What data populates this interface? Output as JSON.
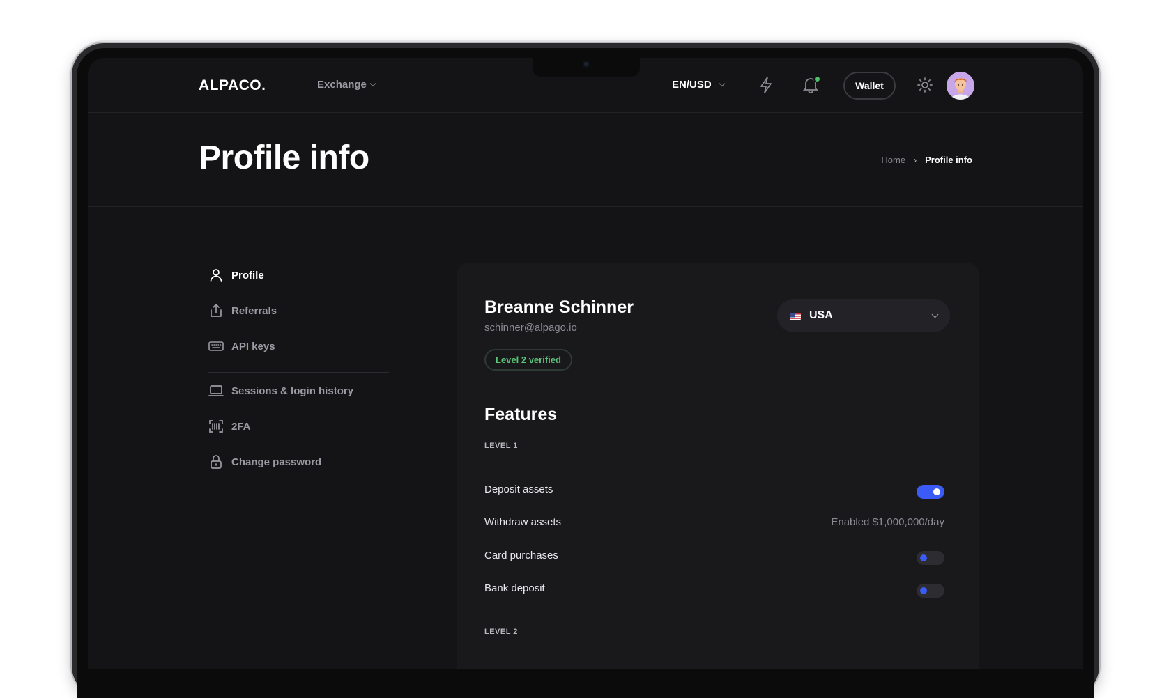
{
  "header": {
    "logo": "ALPACO.",
    "nav_exchange": "Exchange",
    "lang_currency": "EN/USD",
    "wallet_label": "Wallet",
    "notification_dot_color": "#4fc06a"
  },
  "title_band": {
    "title": "Profile info",
    "breadcrumb": {
      "home": "Home",
      "separator": "›",
      "current": "Profile info"
    }
  },
  "sidebar": {
    "items": [
      {
        "label": "Profile",
        "icon": "user-icon",
        "active": true
      },
      {
        "label": "Referrals",
        "icon": "share-icon",
        "active": false
      },
      {
        "label": "API keys",
        "icon": "keyboard-icon",
        "active": false
      },
      {
        "label": "Sessions & login history",
        "icon": "laptop-icon",
        "active": false
      },
      {
        "label": "2FA",
        "icon": "barcode-scan-icon",
        "active": false
      },
      {
        "label": "Change password",
        "icon": "lock-icon",
        "active": false
      }
    ]
  },
  "profile": {
    "name": "Breanne Schinner",
    "email": "schinner@alpago.io",
    "verification_badge": "Level 2 verified",
    "country": "USA",
    "country_flag_icon": "us-flag-icon"
  },
  "features": {
    "title": "Features",
    "levels": [
      {
        "label": "LEVEL 1",
        "items": [
          {
            "label": "Deposit assets",
            "toggle": true
          },
          {
            "label": "Withdraw assets",
            "value": "Enabled $1,000,000/day"
          },
          {
            "label": "Card purchases",
            "toggle": false
          },
          {
            "label": "Bank deposit",
            "toggle": false
          }
        ]
      },
      {
        "label": "LEVEL 2",
        "items": []
      }
    ]
  },
  "colors": {
    "accent": "#3b5bf6",
    "success": "#5cc67a",
    "background": "#141416",
    "card": "#19191c"
  }
}
